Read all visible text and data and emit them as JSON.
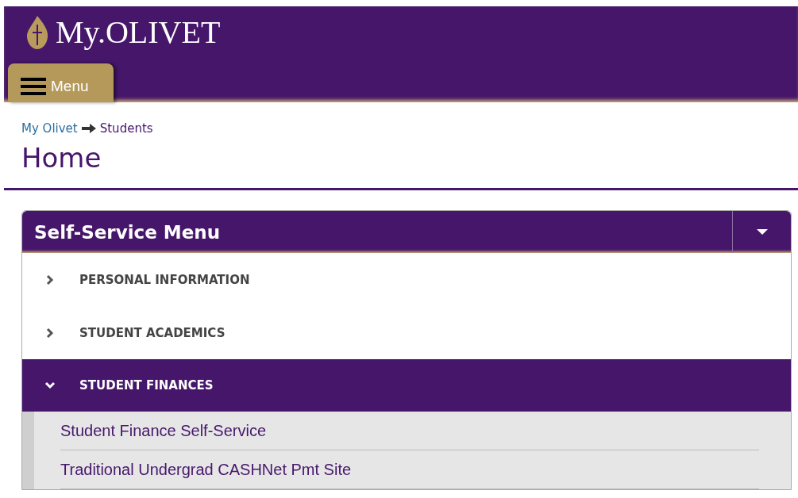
{
  "header": {
    "logo_text": "My.OLIVET",
    "menu_button": "Menu"
  },
  "breadcrumb": [
    {
      "label": "My Olivet",
      "kind": "link"
    },
    {
      "label": "Students",
      "kind": "current"
    }
  ],
  "page_title": "Home",
  "panel": {
    "title": "Self-Service Menu",
    "sections": [
      {
        "label": "PERSONAL INFORMATION",
        "expanded": false
      },
      {
        "label": "STUDENT ACADEMICS",
        "expanded": false
      },
      {
        "label": "STUDENT FINANCES",
        "expanded": true,
        "children": [
          {
            "label": "Student Finance Self-Service"
          },
          {
            "label": "Traditional Undergrad CASHNet Pmt Site"
          }
        ]
      }
    ]
  }
}
